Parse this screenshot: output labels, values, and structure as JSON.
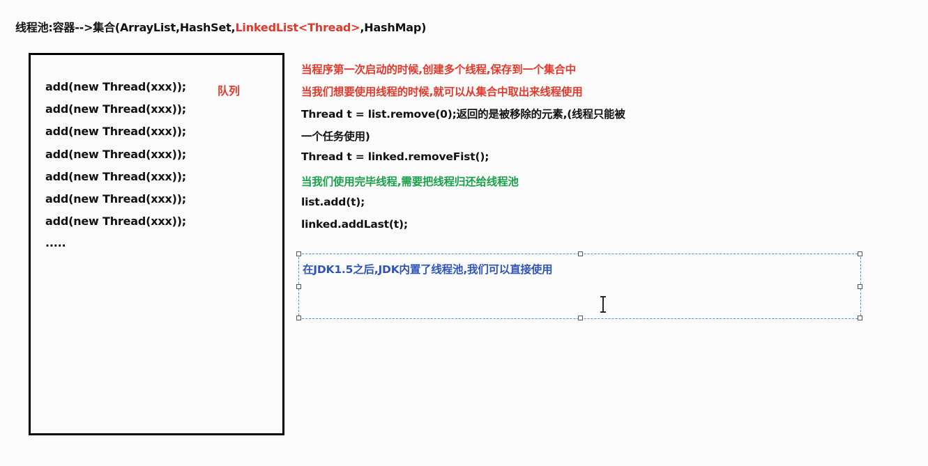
{
  "title": {
    "prefix": "线程池:容器-->集合(ArrayList,HashSet,",
    "highlight": "LinkedList<Thread>",
    "suffix": ",HashMap)"
  },
  "queue_box": {
    "label": "队列",
    "lines": [
      "add(new Thread(xxx));",
      "add(new Thread(xxx));",
      "add(new Thread(xxx));",
      "add(new Thread(xxx));",
      "add(new Thread(xxx));",
      "add(new Thread(xxx));",
      "add(new Thread(xxx));",
      "....."
    ]
  },
  "notes": [
    {
      "text": "当程序第一次启动的时候,创建多个线程,保存到一个集合中",
      "color": "#e03a2c"
    },
    {
      "text": "当我们想要使用线程的时候,就可以从集合中取出来线程使用",
      "color": "#e03a2c"
    },
    {
      "text": "Thread t = list.remove(0);返回的是被移除的元素,(线程只能被",
      "color": "#111111"
    },
    {
      "text": "一个任务使用)",
      "color": "#111111"
    },
    {
      "text": "Thread t = linked.removeFist();",
      "color": "#111111"
    },
    {
      "text": "当我们使用完毕线程,需要把线程归还给线程池",
      "color": "#1aa24a"
    },
    {
      "text": "list.add(t);",
      "color": "#111111"
    },
    {
      "text": "linked.addLast(t);",
      "color": "#111111"
    }
  ],
  "selected_textbox": {
    "text": "在JDK1.5之后,JDK内置了线程池,我们可以直接使用",
    "color": "#2e55b8"
  },
  "colors": {
    "accent_red": "#e03a2c",
    "accent_green": "#1aa24a",
    "accent_blue": "#2e55b8",
    "selection_border": "#4b8fd4"
  },
  "icons": {
    "cursor": "text-cursor-icon"
  }
}
